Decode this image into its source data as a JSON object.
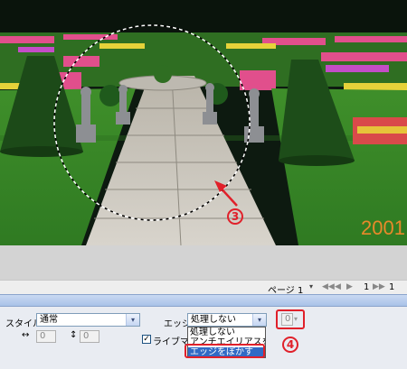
{
  "canvas": {
    "year_stamp": "2001",
    "callout_3": "3"
  },
  "pagebar": {
    "page_label": "ページ 1",
    "page_menu_glyph": "▾",
    "nav_first": "◀◀",
    "nav_prev": "◀",
    "nav_next": "▶",
    "nav_last": "▶▶",
    "page_number": "1",
    "page_total": "1"
  },
  "panel": {
    "style_label": "スタイル：",
    "style_value": "通常",
    "edge_label": "エッジ：",
    "edge_value": "処理しない",
    "blur_value": "0",
    "width_value": "0",
    "height_value": "0",
    "live_mark_label": "ライブマーキ",
    "edge_options": [
      "処理しない",
      "アンチエイリアスをオン",
      "エッジをぼかす"
    ],
    "edge_selected_index": 2,
    "callout_4": "4",
    "dropdown_arrow": "▾",
    "width_icon": "↔",
    "height_icon": "↕",
    "checkmark": "✓"
  },
  "colors": {
    "highlight": "#e0202a",
    "selection": "#316ac5",
    "year_stamp": "#e8892a"
  }
}
